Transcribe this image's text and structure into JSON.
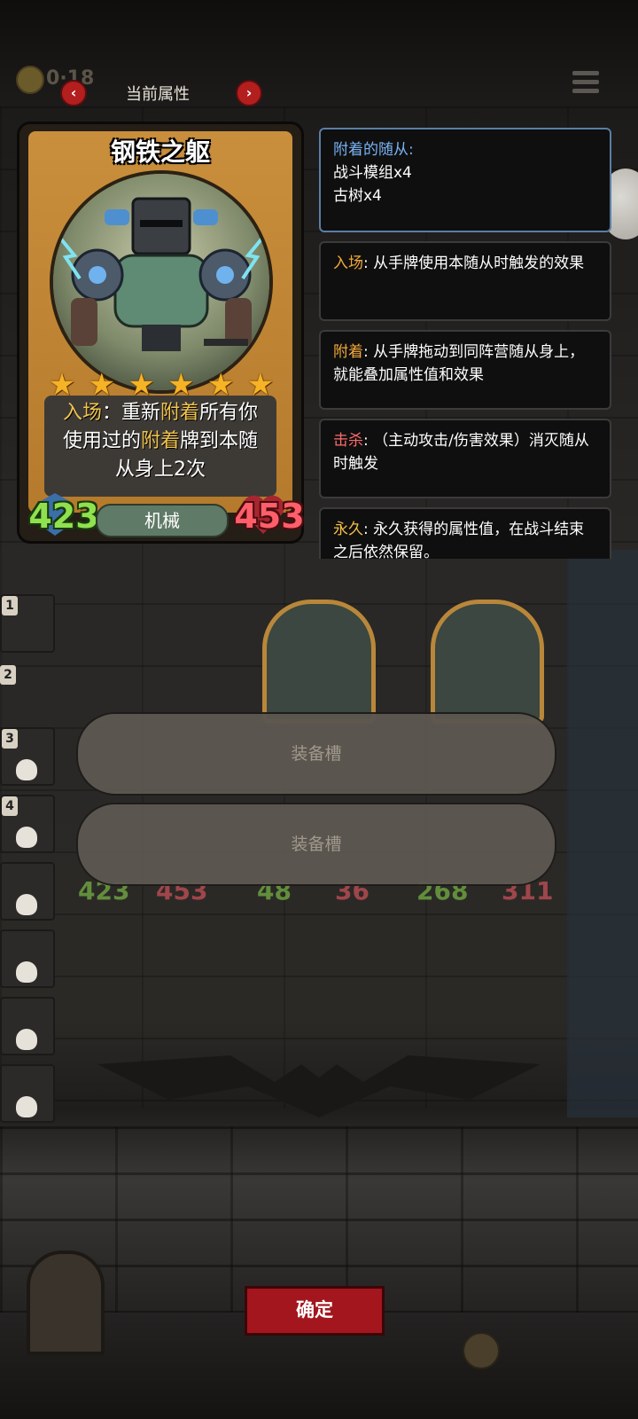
{
  "top_bar": {
    "coins": "0",
    "coins_suffix": "18",
    "title": "当前属性",
    "prev_label": "‹",
    "next_label": "›"
  },
  "card": {
    "name": "钢铁之躯",
    "stars": 6,
    "desc_parts": {
      "p1": "入场",
      "p2": "：重新",
      "p3": "附着",
      "p4": "所有你",
      "p5": "使用过的",
      "p6": "附着",
      "p7": "牌到本随",
      "p8": "从身上2次"
    },
    "attack": "423",
    "health": "453",
    "tribe": "机械"
  },
  "info_boxes": {
    "attached": {
      "heading": "附着的随从:",
      "line1": "战斗模组x4",
      "line2": "古树x4"
    },
    "enter": {
      "keyword": "入场",
      "text": ": 从手牌使用本随从时触发的效果"
    },
    "attach": {
      "keyword": "附着",
      "text": ": 从手牌拖动到同阵营随从身上，就能叠加属性值和效果"
    },
    "kill": {
      "keyword": "击杀",
      "text": ": （主动攻击/伤害效果）消灭随从时触发"
    },
    "permanent": {
      "keyword": "永久",
      "text": ": 永久获得的属性值，在战斗结束之后依然保留。"
    }
  },
  "roster_numbers": [
    "1",
    "2",
    "3",
    "4"
  ],
  "equip_slots": [
    "装备槽",
    "装备槽"
  ],
  "board_stats": {
    "left_atk": "423",
    "left_hp": "453",
    "mid_atk": "48",
    "mid_hp": "36",
    "right_atk": "268",
    "right_hp": "311"
  },
  "confirm_label": "确定",
  "colors": {
    "keyword_gold": "#f1c34d",
    "attack_green": "#8fe14f",
    "health_red": "#ff5f6a",
    "confirm_red": "#a3161d"
  }
}
